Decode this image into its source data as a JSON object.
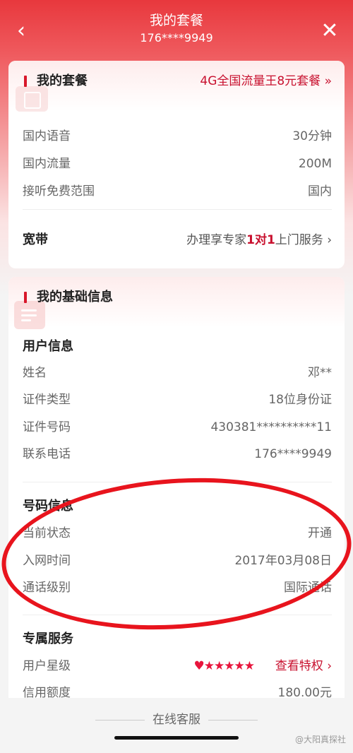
{
  "nav": {
    "title": "我的套餐",
    "subtitle": "176****9949",
    "back_icon": "‹",
    "close_icon": "✕"
  },
  "package": {
    "title": "我的套餐",
    "plan_name": "4G全国流量王8元套餐 »",
    "items": [
      {
        "label": "国内语音",
        "value": "30分钟"
      },
      {
        "label": "国内流量",
        "value": "200M"
      },
      {
        "label": "接听免费范围",
        "value": "国内"
      }
    ],
    "broadband": {
      "label": "宽带",
      "value_pre": "办理享专家",
      "value_em": "1对1",
      "value_post": "上门服务 ›"
    }
  },
  "basic": {
    "title": "我的基础信息",
    "user_section": "用户信息",
    "user_items": [
      {
        "label": "姓名",
        "value": "邓**"
      },
      {
        "label": "证件类型",
        "value": "18位身份证"
      },
      {
        "label": "证件号码",
        "value": "430381**********11"
      },
      {
        "label": "联系电话",
        "value": "176****9949"
      }
    ],
    "number_section": "号码信息",
    "number_items": [
      {
        "label": "当前状态",
        "value": "开通"
      },
      {
        "label": "入网时间",
        "value": "2017年03月08日"
      },
      {
        "label": "通话级别",
        "value": "国际通话"
      }
    ],
    "service_section": "专属服务",
    "star_label": "用户星级",
    "stars": "♥★★★★★",
    "view_privilege": "查看特权 ›",
    "credit_label": "信用额度",
    "credit_value": "180.00元"
  },
  "footer": {
    "service": "在线客服",
    "watermark": "@大阳真探社"
  },
  "colors": {
    "brand_red": "#c8102e",
    "accent_red": "#d8172a",
    "annotation_red": "#e8141d"
  }
}
